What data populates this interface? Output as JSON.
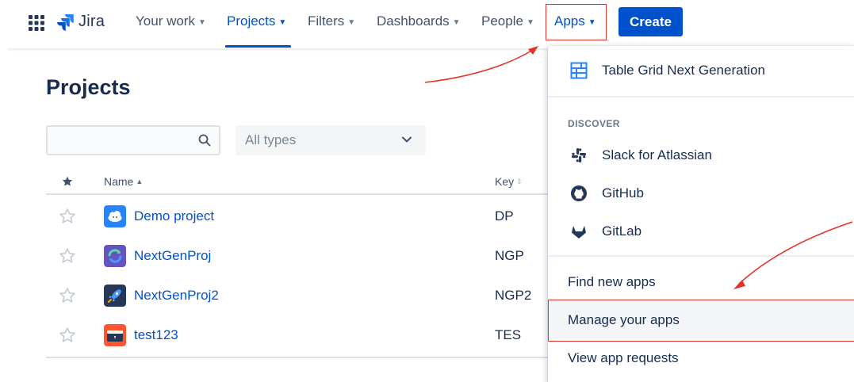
{
  "nav": {
    "logo_text": "Jira",
    "items": [
      {
        "label": "Your work"
      },
      {
        "label": "Projects"
      },
      {
        "label": "Filters"
      },
      {
        "label": "Dashboards"
      },
      {
        "label": "People"
      },
      {
        "label": "Apps"
      }
    ],
    "active_item": "Projects",
    "create_label": "Create"
  },
  "page": {
    "title": "Projects",
    "search": {
      "value": "",
      "placeholder": ""
    },
    "type_filter": {
      "selected": "All types"
    },
    "table": {
      "columns": [
        "Name",
        "Key"
      ],
      "rows": [
        {
          "name": "Demo project",
          "key": "DP",
          "avatar": "cloud-avatar-icon"
        },
        {
          "name": "NextGenProj",
          "key": "NGP",
          "avatar": "refresh-avatar-icon"
        },
        {
          "name": "NextGenProj2",
          "key": "NGP2",
          "avatar": "rocket-avatar-icon"
        },
        {
          "name": "test123",
          "key": "TES",
          "avatar": "window-avatar-icon"
        }
      ]
    }
  },
  "apps_menu": {
    "installed": [
      {
        "label": "Table Grid Next Generation",
        "icon": "table-grid-icon"
      }
    ],
    "discover_heading": "DISCOVER",
    "discover": [
      {
        "label": "Slack for Atlassian",
        "icon": "slack-icon"
      },
      {
        "label": "GitHub",
        "icon": "github-icon"
      },
      {
        "label": "GitLab",
        "icon": "gitlab-icon"
      }
    ],
    "actions": [
      {
        "label": "Find new apps"
      },
      {
        "label": "Manage your apps"
      },
      {
        "label": "View app requests"
      }
    ],
    "highlighted_action": "Manage your apps"
  },
  "colors": {
    "brand_blue": "#0052cc",
    "annotation_red": "#e5332a",
    "text_primary": "#172b4d",
    "text_secondary": "#42526e"
  }
}
